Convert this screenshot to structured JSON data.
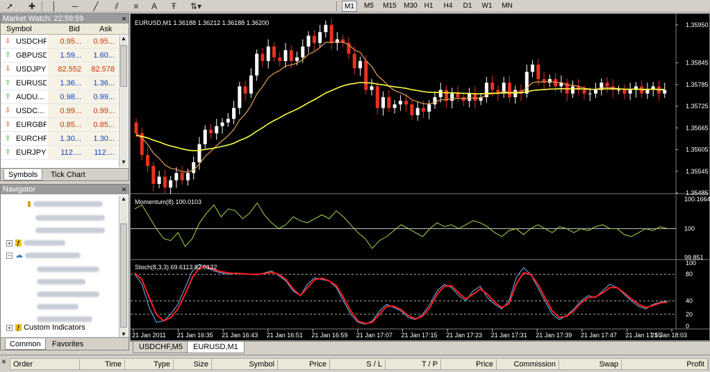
{
  "toolbar": {
    "icons": [
      "cursor-icon",
      "crosshair-icon",
      "vertical-line-icon",
      "horizontal-line-icon",
      "trendline-icon",
      "equidistant-channel-icon",
      "fibonacci-icon",
      "text-icon",
      "text-label-icon",
      "arrows-icon"
    ],
    "text_tool": "A",
    "timeframes": [
      "M1",
      "M5",
      "M15",
      "M30",
      "H1",
      "H4",
      "D1",
      "W1",
      "MN"
    ],
    "active_timeframe": "M1"
  },
  "market_watch": {
    "title": "Market Watch: 22:59:59",
    "columns": {
      "symbol": "Symbol",
      "bid": "Bid",
      "ask": "Ask"
    },
    "rows": [
      {
        "symbol": "USDCHF",
        "bid": "0.95...",
        "ask": "0.95...",
        "dir": "down",
        "color": "red"
      },
      {
        "symbol": "GBPUSD",
        "bid": "1.59...",
        "ask": "1.60...",
        "dir": "up",
        "color": "blue"
      },
      {
        "symbol": "USDJPY",
        "bid": "82.552",
        "ask": "82.578",
        "dir": "down",
        "color": "red"
      },
      {
        "symbol": "EURUSD",
        "bid": "1.36...",
        "ask": "1.36...",
        "dir": "up",
        "color": "blue"
      },
      {
        "symbol": "AUDU...",
        "bid": "0.98...",
        "ask": "0.99...",
        "dir": "up",
        "color": "blue"
      },
      {
        "symbol": "USDC...",
        "bid": "0.99...",
        "ask": "0.99...",
        "dir": "down",
        "color": "red"
      },
      {
        "symbol": "EURGBP",
        "bid": "0.85...",
        "ask": "0.85...",
        "dir": "down",
        "color": "red"
      },
      {
        "symbol": "EURCHF",
        "bid": "1.30...",
        "ask": "1.30...",
        "dir": "up",
        "color": "blue"
      },
      {
        "symbol": "EURJPY",
        "bid": "112....",
        "ask": "112....",
        "dir": "up",
        "color": "blue"
      }
    ],
    "tabs": [
      "Symbols",
      "Tick Chart"
    ],
    "active_tab": "Symbols"
  },
  "navigator": {
    "title": "Navigator",
    "custom_indicators": "Custom Indicators",
    "tabs": [
      "Common",
      "Favorites"
    ],
    "active_tab": "Common"
  },
  "chart": {
    "main_label": "EURUSD,M1  1.36188 1.36212 1.36188 1.36200",
    "momentum_label": "Momentum(8) 100.0103",
    "stoch_label": "Stoch(8,3,3) 69.6113 82.0132",
    "colors": {
      "bull": "#ffffff",
      "bear": "#e8321e",
      "ma_fast": "#e8a050",
      "ma_slow": "#ffff40",
      "momentum": "#a8d848",
      "stoch_main": "#70b8ff",
      "stoch_signal": "#ff2020",
      "grid": "#808080"
    }
  },
  "chart_tabs": [
    "USDCHF,M5",
    "EURUSD,M1"
  ],
  "active_chart_tab": "EURUSD,M1",
  "terminal": {
    "columns": [
      "Order",
      "Time",
      "Type",
      "Size",
      "Symbol",
      "Price",
      "S / L",
      "T / P",
      "Price",
      "Commission",
      "Swap",
      "Profit"
    ]
  },
  "chart_data": {
    "type": "candlestick",
    "symbol": "EURUSD",
    "timeframe": "M1",
    "ylim": [
      1.35485,
      1.35965
    ],
    "y_ticks": [
      "1.35950",
      "1.35845",
      "1.35785",
      "1.35725",
      "1.35665",
      "1.35605",
      "1.35545",
      "1.35485"
    ],
    "x_ticks": [
      "21 Jan 2011",
      "21 Jan 16:35",
      "21 Jan 16:43",
      "21 Jan 16:51",
      "21 Jan 16:59",
      "21 Jan 17:07",
      "21 Jan 17:15",
      "21 Jan 17:23",
      "21 Jan 17:31",
      "21 Jan 17:39",
      "21 Jan 17:47",
      "21 Jan 17:55",
      "21 Jan 18:03"
    ],
    "close": [
      1.3565,
      1.3559,
      1.3556,
      1.3551,
      1.3553,
      1.355,
      1.3552,
      1.3554,
      1.3552,
      1.3554,
      1.3557,
      1.3562,
      1.3566,
      1.3565,
      1.3567,
      1.3568,
      1.3569,
      1.3572,
      1.3578,
      1.3576,
      1.3581,
      1.3587,
      1.3585,
      1.3589,
      1.3586,
      1.3585,
      1.3588,
      1.3585,
      1.3586,
      1.3589,
      1.3592,
      1.359,
      1.3593,
      1.3595,
      1.359,
      1.3591,
      1.359,
      1.3587,
      1.3583,
      1.3585,
      1.3577,
      1.3578,
      1.3572,
      1.3575,
      1.3572,
      1.3573,
      1.3574,
      1.3573,
      1.357,
      1.3572,
      1.3571,
      1.3573,
      1.3575,
      1.3577,
      1.3574,
      1.3576,
      1.3575,
      1.3574,
      1.3576,
      1.3574,
      1.3575,
      1.3579,
      1.3577,
      1.3576,
      1.3579,
      1.3575,
      1.3577,
      1.3576,
      1.3582,
      1.3584,
      1.358,
      1.3579,
      1.358,
      1.3578,
      1.3579,
      1.3576,
      1.3578,
      1.3577,
      1.3576,
      1.3576,
      1.3577,
      1.3579,
      1.3578,
      1.3577,
      1.3577,
      1.3576,
      1.3577,
      1.3578,
      1.3576,
      1.3577,
      1.3578,
      1.3576,
      1.3577
    ],
    "momentum_ylim": [
      99.851,
      100.1664
    ],
    "momentum_level": 100,
    "momentum": [
      100.1,
      100.12,
      100.06,
      100.0,
      99.95,
      99.94,
      99.98,
      99.91,
      99.95,
      100.03,
      100.08,
      100.12,
      100.06,
      100.1,
      100.09,
      100.05,
      100.08,
      100.13,
      100.07,
      100.03,
      100.0,
      100.02,
      100.06,
      100.04,
      100.03,
      100.05,
      100.07,
      100.05,
      100.09,
      100.06,
      100.02,
      99.98,
      99.95,
      99.9,
      99.94,
      99.96,
      99.99,
      100.02,
      100.0,
      99.98,
      99.96,
      100.0,
      100.03,
      100.01,
      100.02,
      100.0,
      100.02,
      100.04,
      100.03,
      100.01,
      99.98,
      99.96,
      99.99,
      100.0,
      99.97,
      100.0,
      100.02,
      100.0,
      99.98,
      100.01,
      100.0,
      99.98,
      100.0,
      99.99,
      100.01,
      100.02,
      100.0,
      100.0,
      99.97,
      99.96,
      99.98,
      100.0,
      99.99,
      100.01,
      100.0
    ],
    "stoch_levels": [
      80,
      40,
      20
    ],
    "stoch_main": [
      80,
      65,
      30,
      8,
      10,
      20,
      35,
      60,
      85,
      95,
      90,
      85,
      82,
      80,
      82,
      81,
      80,
      79,
      82,
      85,
      78,
      70,
      55,
      48,
      65,
      75,
      72,
      70,
      60,
      40,
      20,
      8,
      5,
      10,
      25,
      35,
      30,
      25,
      15,
      12,
      20,
      35,
      55,
      65,
      60,
      48,
      40,
      55,
      62,
      45,
      35,
      28,
      40,
      75,
      90,
      80,
      60,
      40,
      20,
      12,
      18,
      28,
      40,
      48,
      45,
      55,
      65,
      60,
      50,
      40,
      32,
      28,
      35,
      38,
      40
    ],
    "stoch_signal": [
      82,
      72,
      45,
      20,
      10,
      15,
      28,
      50,
      75,
      90,
      92,
      87,
      84,
      82,
      81,
      81,
      80,
      80,
      81,
      83,
      80,
      72,
      58,
      48,
      60,
      72,
      74,
      70,
      63,
      45,
      25,
      10,
      6,
      8,
      20,
      32,
      32,
      27,
      18,
      13,
      17,
      30,
      50,
      62,
      63,
      52,
      43,
      50,
      58,
      50,
      38,
      30,
      36,
      65,
      82,
      80,
      65,
      45,
      25,
      15,
      17,
      25,
      37,
      45,
      46,
      52,
      60,
      60,
      52,
      43,
      35,
      30,
      33,
      37,
      38
    ]
  }
}
